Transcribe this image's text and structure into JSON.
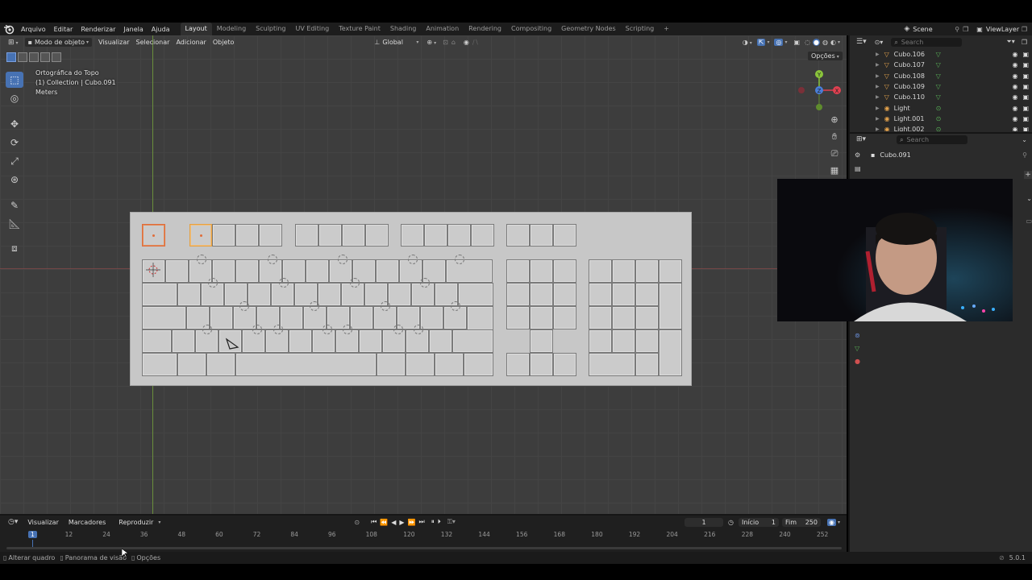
{
  "app": {
    "version": "5.0.1"
  },
  "topbar": {
    "menus": [
      "Arquivo",
      "Editar",
      "Renderizar",
      "Janela",
      "Ajuda"
    ],
    "workspaces": [
      "Layout",
      "Modeling",
      "Sculpting",
      "UV Editing",
      "Texture Paint",
      "Shading",
      "Animation",
      "Rendering",
      "Compositing",
      "Geometry Nodes",
      "Scripting"
    ],
    "active_workspace": "Layout",
    "add_tab": "+",
    "scene": "Scene",
    "view_layer": "ViewLayer"
  },
  "viewport_header": {
    "mode": "Modo de objeto",
    "menus": [
      "Visualizar",
      "Selecionar",
      "Adicionar",
      "Objeto"
    ],
    "orientation": "Global",
    "options": "Opções"
  },
  "viewport_info": {
    "view_name": "Ortográfica do Topo",
    "collection": "(1) Collection | Cubo.091",
    "units": "Meters"
  },
  "gizmo": {
    "x": "X",
    "y": "Y",
    "z": "Z"
  },
  "outliner": {
    "search_placeholder": "Search",
    "items": [
      {
        "name": "Cubo.106",
        "type": "mesh"
      },
      {
        "name": "Cubo.107",
        "type": "mesh"
      },
      {
        "name": "Cubo.108",
        "type": "mesh"
      },
      {
        "name": "Cubo.109",
        "type": "mesh"
      },
      {
        "name": "Cubo.110",
        "type": "mesh"
      },
      {
        "name": "Light",
        "type": "light"
      },
      {
        "name": "Light.001",
        "type": "light"
      },
      {
        "name": "Light.002",
        "type": "light"
      }
    ]
  },
  "properties": {
    "search_placeholder": "Search",
    "object_name": "Cubo.091"
  },
  "timeline": {
    "menus": [
      "Visualizar",
      "Marcadores",
      "Reproduzir"
    ],
    "current_frame": "1",
    "start_label": "Início",
    "start": "1",
    "end_label": "Fim",
    "end": "250",
    "ticks": [
      "1",
      "12",
      "24",
      "36",
      "48",
      "60",
      "72",
      "84",
      "96",
      "108",
      "120",
      "132",
      "144",
      "156",
      "168",
      "180",
      "192",
      "204",
      "216",
      "228",
      "240",
      "252"
    ]
  },
  "statusbar": {
    "items": [
      "Alterar quadro",
      "Panorama de visão",
      "Opções"
    ],
    "version": "5.0.1"
  },
  "colors": {
    "accent": "#4772b3",
    "selection": "#e06d3a",
    "active_selection": "#e6a040",
    "mesh_icon": "#e3a24c",
    "light_icon": "#58b056"
  }
}
